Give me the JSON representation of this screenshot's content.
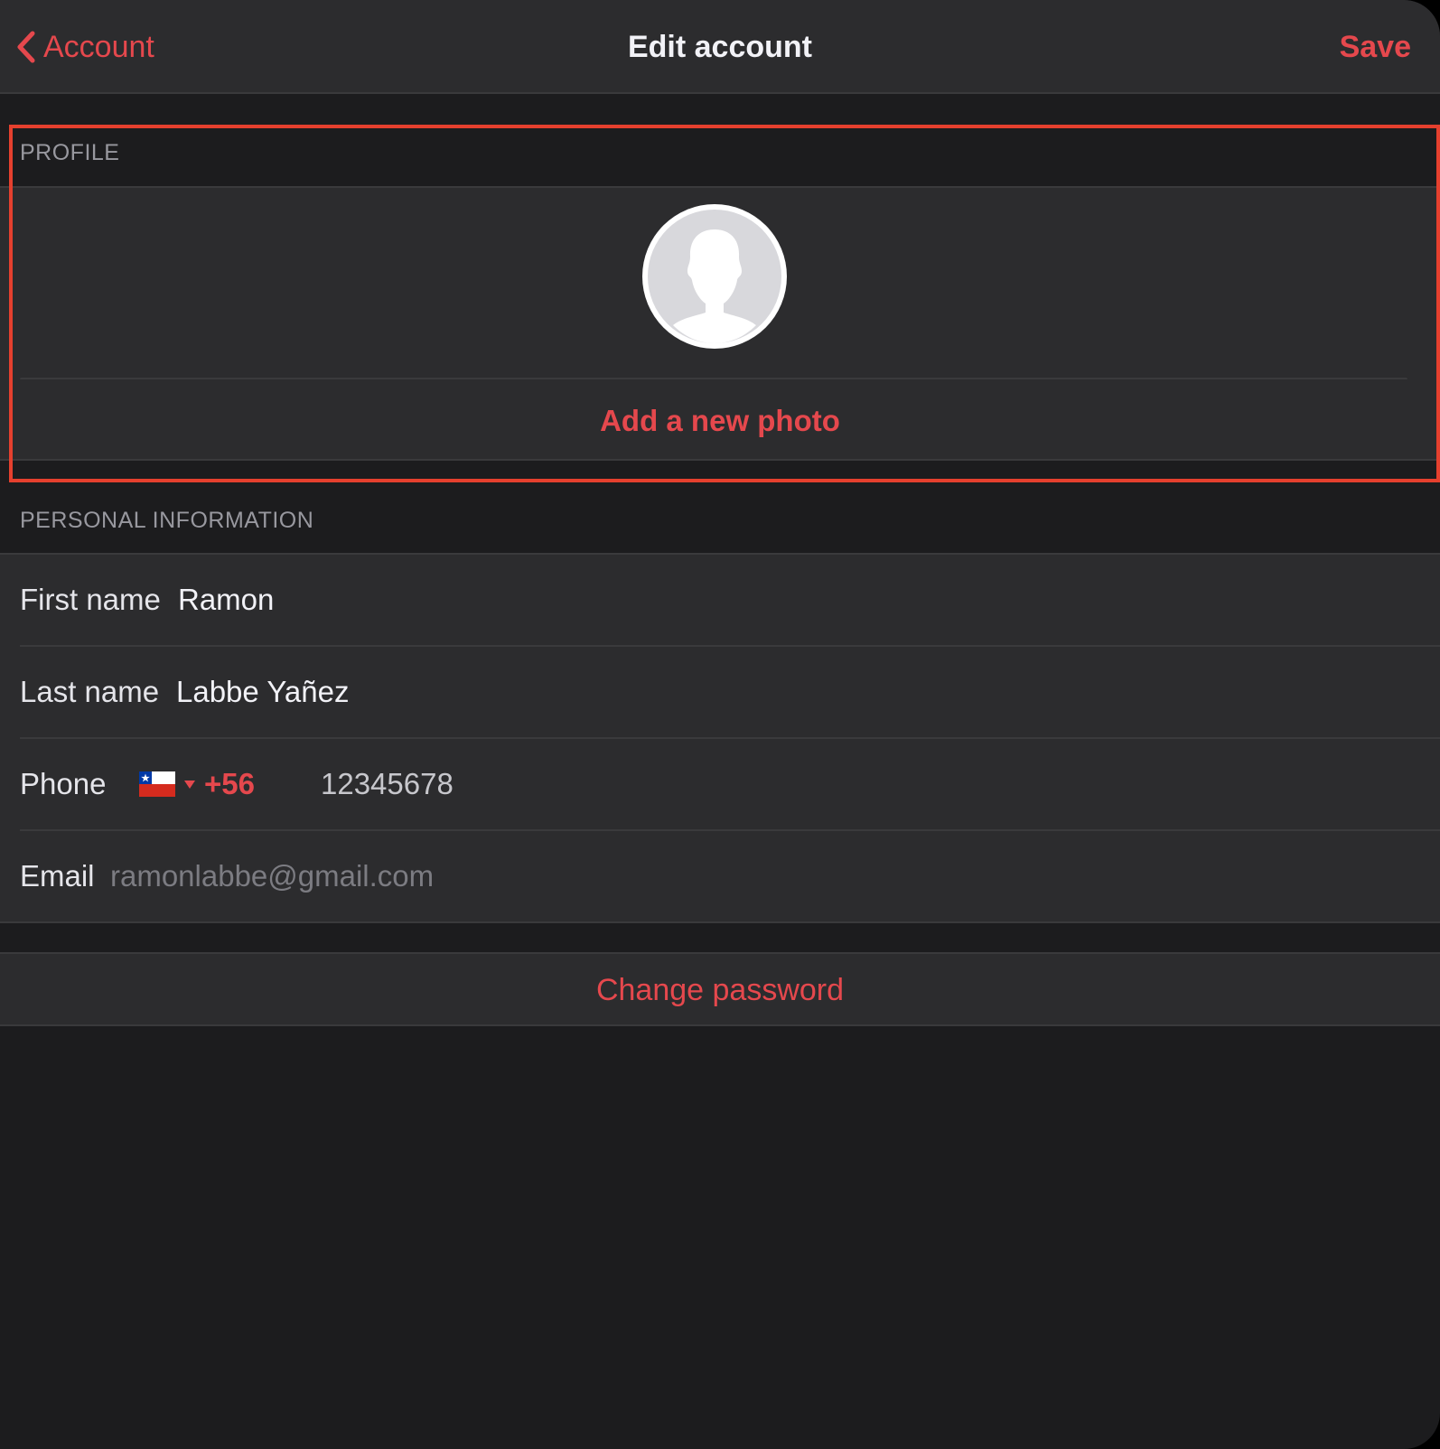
{
  "navbar": {
    "back_label": "Account",
    "title": "Edit account",
    "save_label": "Save"
  },
  "profile": {
    "header": "PROFILE",
    "add_photo_label": "Add a new photo"
  },
  "personal": {
    "header": "PERSONAL INFORMATION",
    "first_name": {
      "label": "First name",
      "value": "Ramon"
    },
    "last_name": {
      "label": "Last name",
      "value": "Labbe Yañez"
    },
    "phone": {
      "label": "Phone",
      "country_flag": "chile-flag",
      "dial_code": "+56",
      "number": "12345678"
    },
    "email": {
      "label": "Email",
      "placeholder": "ramonlabbe@gmail.com"
    }
  },
  "security": {
    "change_password_label": "Change password"
  },
  "theme": {
    "accent": "#e5484d",
    "highlight": "#e5402e",
    "background": "#1c1c1e",
    "cell": "#2c2c2e"
  }
}
